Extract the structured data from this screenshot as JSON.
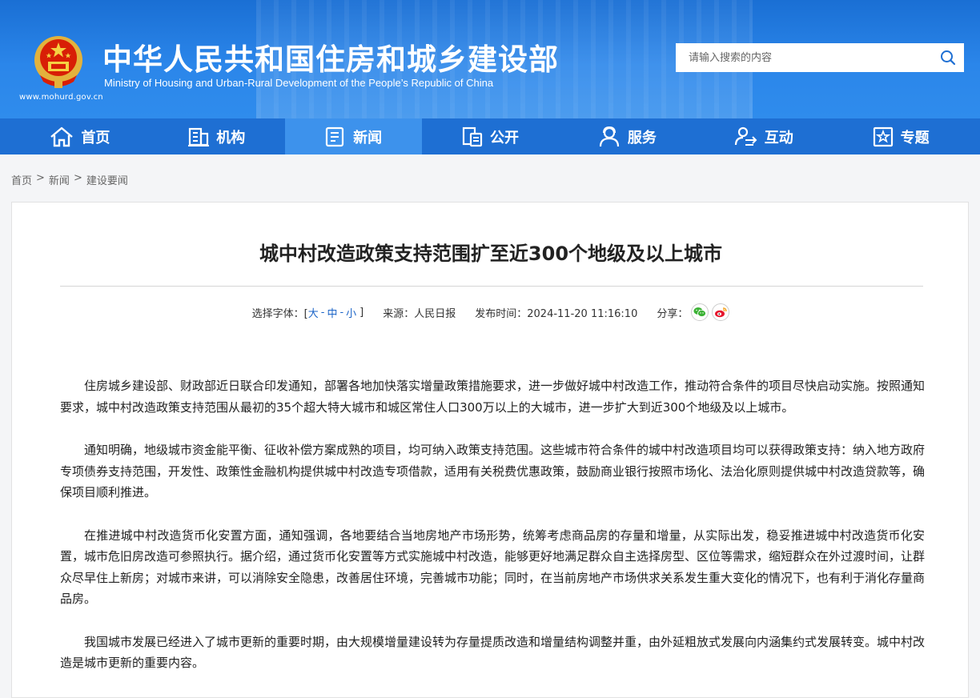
{
  "header": {
    "title_cn": "中华人民共和国住房和城乡建设部",
    "title_en": "Ministry of Housing and Urban-Rural Development of the People’s Republic of China",
    "site_url": "www.mohurd.gov.cn",
    "search_placeholder": "请输入搜索的内容"
  },
  "nav": [
    {
      "label": "首页",
      "icon": "home-icon"
    },
    {
      "label": "机构",
      "icon": "building-icon"
    },
    {
      "label": "新闻",
      "icon": "news-icon",
      "active": true
    },
    {
      "label": "公开",
      "icon": "disclosure-icon"
    },
    {
      "label": "服务",
      "icon": "service-icon"
    },
    {
      "label": "互动",
      "icon": "interaction-icon"
    },
    {
      "label": "专题",
      "icon": "topic-icon"
    }
  ],
  "breadcrumb": [
    "首页",
    "新闻",
    "建设要闻"
  ],
  "breadcrumb_sep": ">",
  "article": {
    "title": "城中村改造政策支持范围扩至近300个地级及以上城市",
    "meta": {
      "font_label": "选择字体：[",
      "font_large": "大",
      "font_medium": "中",
      "font_small": "小",
      "font_sep": "-",
      "font_close": "]",
      "source": "来源：人民日报",
      "published": "发布时间：2024-11-20 11:16:10",
      "share_label": "分享："
    },
    "paragraphs": [
      "住房城乡建设部、财政部近日联合印发通知，部署各地加快落实增量政策措施要求，进一步做好城中村改造工作，推动符合条件的项目尽快启动实施。按照通知要求，城中村改造政策支持范围从最初的35个超大特大城市和城区常住人口300万以上的大城市，进一步扩大到近300个地级及以上城市。",
      "通知明确，地级城市资金能平衡、征收补偿方案成熟的项目，均可纳入政策支持范围。这些城市符合条件的城中村改造项目均可以获得政策支持：纳入地方政府专项债券支持范围，开发性、政策性金融机构提供城中村改造专项借款，适用有关税费优惠政策，鼓励商业银行按照市场化、法治化原则提供城中村改造贷款等，确保项目顺利推进。",
      "在推进城中村改造货币化安置方面，通知强调，各地要结合当地房地产市场形势，统筹考虑商品房的存量和增量，从实际出发，稳妥推进城中村改造货币化安置，城市危旧房改造可参照执行。据介绍，通过货币化安置等方式实施城中村改造，能够更好地满足群众自主选择房型、区位等需求，缩短群众在外过渡时间，让群众尽早住上新房；对城市来讲，可以消除安全隐患，改善居住环境，完善城市功能；同时，在当前房地产市场供求关系发生重大变化的情况下，也有利于消化存量商品房。",
      "我国城市发展已经进入了城市更新的重要时期，由大规模增量建设转为存量提质改造和增量结构调整并重，由外延粗放式发展向内涵集约式发展转变。城中村改造是城市更新的重要内容。"
    ]
  },
  "colors": {
    "header_blue": "#2b86ea",
    "nav_blue": "#1e6fd3",
    "nav_active": "#3d92ec",
    "link_blue": "#1a63c7",
    "wechat_green": "#3bb234",
    "weibo_red": "#e6162d"
  }
}
